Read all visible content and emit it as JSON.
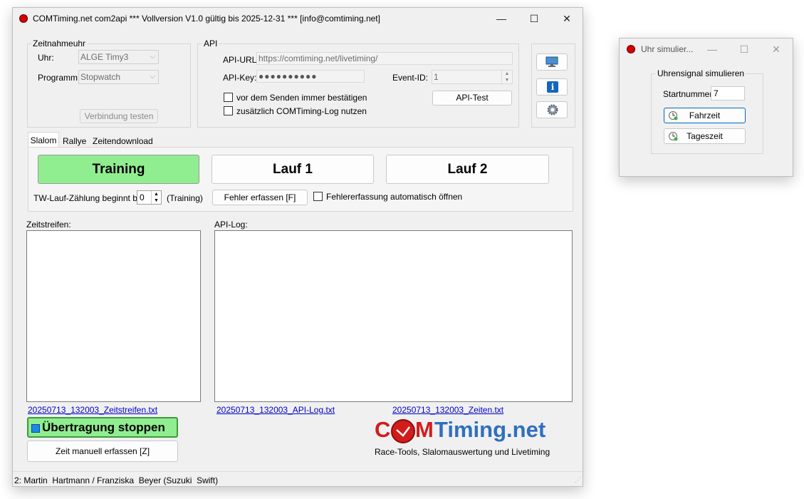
{
  "main_window": {
    "title": "COMTiming.net com2api *** Vollversion V1.0 gültig bis 2025-12-31 *** [info@comtiming.net]",
    "controls": {
      "minimize": "—",
      "maximize": "☐",
      "close": "✕"
    },
    "zeitnahmeuhr": {
      "group_label": "Zeitnahmeuhr",
      "uhr_label": "Uhr:",
      "uhr_value": "ALGE Timy3",
      "programm_label": "Programm:",
      "programm_value": "Stopwatch",
      "test_button": "Verbindung testen"
    },
    "api": {
      "group_label": "API",
      "url_label": "API-URL:",
      "url_value": "https://comtiming.net/livetiming/",
      "key_label": "API-Key:",
      "key_value": "●●●●●●●●●●",
      "event_label": "Event-ID:",
      "event_value": "1",
      "confirm_label": "vor dem Senden immer bestätigen",
      "log_label": "zusätzlich COMTiming-Log nutzen",
      "test_button": "API-Test"
    },
    "tabs": [
      "Slalom",
      "Rallye",
      "Zeitendownload"
    ],
    "run_buttons": {
      "training": "Training",
      "lauf1": "Lauf 1",
      "lauf2": "Lauf 2"
    },
    "colors": {
      "training_active": "#90ee90",
      "link": "#0000c8",
      "brand_red": "#d21c1c",
      "brand_blue": "#2f6fbf"
    },
    "tw_label": "TW-Lauf-Zählung beginnt bei:",
    "tw_value": "0",
    "tw_suffix": "(Training)",
    "fehler_button": "Fehler erfassen [F]",
    "fehler_auto_label": "Fehlererfassung automatisch öffnen",
    "zeitstreifen_label": "Zeitstreifen:",
    "apilog_label": "API-Log:",
    "links": {
      "zeitstreifen": "20250713_132003_Zeitstreifen.txt",
      "apilog": "20250713_132003_API-Log.txt",
      "zeiten": "20250713_132003_Zeiten.txt"
    },
    "stop_button": "Übertragung stoppen",
    "manual_button": "Zeit manuell erfassen [Z]",
    "logo": {
      "part1": "C",
      "part2": "M",
      "part3": "Timing.net",
      "tagline": "Race-Tools, Slalomauswertung und Livetiming"
    },
    "status": "2: Martin  Hartmann / Franziska  Beyer (Suzuki  Swift)"
  },
  "sim_window": {
    "title": "Uhr simulier...",
    "controls": {
      "minimize": "—",
      "maximize": "☐",
      "close": "✕"
    },
    "group_label": "Uhrensignal simulieren",
    "startnr_label": "Startnummer:",
    "startnr_value": "7",
    "fahrzeit_button": "Fahrzeit",
    "tageszeit_button": "Tageszeit"
  }
}
